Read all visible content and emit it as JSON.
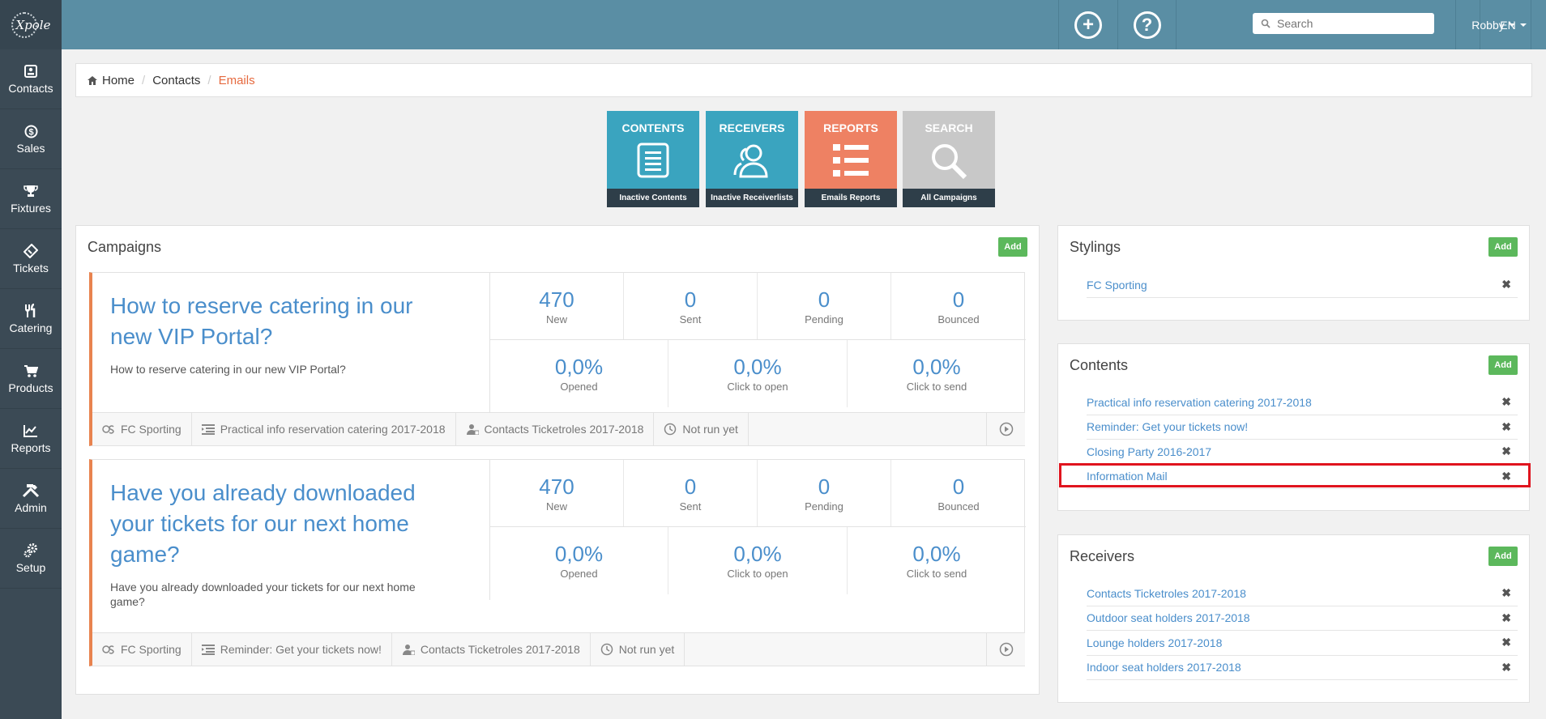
{
  "sidebar": {
    "logo_text": "Xpole",
    "items": [
      {
        "label": "Contacts",
        "icon": "contacts-icon"
      },
      {
        "label": "Sales",
        "icon": "dollar-icon"
      },
      {
        "label": "Fixtures",
        "icon": "trophy-icon"
      },
      {
        "label": "Tickets",
        "icon": "ticket-icon"
      },
      {
        "label": "Catering",
        "icon": "cutlery-icon"
      },
      {
        "label": "Products",
        "icon": "cart-icon"
      },
      {
        "label": "Reports",
        "icon": "line-chart-icon"
      },
      {
        "label": "Admin",
        "icon": "tools-icon"
      },
      {
        "label": "Setup",
        "icon": "gears-icon"
      }
    ]
  },
  "topbar": {
    "search_placeholder": "Search",
    "user": "Robby",
    "language": "EN"
  },
  "breadcrumb": {
    "home": "Home",
    "contacts": "Contacts",
    "current": "Emails"
  },
  "tiles": [
    {
      "title": "CONTENTS",
      "footer": "Inactive Contents",
      "color": "#3aa4bf"
    },
    {
      "title": "RECEIVERS",
      "footer": "Inactive Receiverlists",
      "color": "#3aa4bf"
    },
    {
      "title": "REPORTS",
      "footer": "Emails Reports",
      "color": "#ee8163"
    },
    {
      "title": "SEARCH",
      "footer": "All Campaigns",
      "color": "#c8c8c8"
    }
  ],
  "campaigns": {
    "title": "Campaigns",
    "add_label": "Add",
    "items": [
      {
        "title": "How to reserve catering in our new VIP Portal?",
        "description": "How to reserve catering in our new VIP Portal?",
        "stats_top": [
          {
            "value": "470",
            "label": "New"
          },
          {
            "value": "0",
            "label": "Sent"
          },
          {
            "value": "0",
            "label": "Pending"
          },
          {
            "value": "0",
            "label": "Bounced"
          }
        ],
        "stats_bottom": [
          {
            "value": "0,0%",
            "label": "Opened"
          },
          {
            "value": "0,0%",
            "label": "Click to open"
          },
          {
            "value": "0,0%",
            "label": "Click to send"
          }
        ],
        "styling": "FC Sporting",
        "content": "Practical info reservation catering 2017-2018",
        "receivers": "Contacts Ticketroles 2017-2018",
        "status": "Not run yet"
      },
      {
        "title": "Have you already downloaded your tickets for our next home game?",
        "description": "Have you already downloaded your tickets for our next home game?",
        "stats_top": [
          {
            "value": "470",
            "label": "New"
          },
          {
            "value": "0",
            "label": "Sent"
          },
          {
            "value": "0",
            "label": "Pending"
          },
          {
            "value": "0",
            "label": "Bounced"
          }
        ],
        "stats_bottom": [
          {
            "value": "0,0%",
            "label": "Opened"
          },
          {
            "value": "0,0%",
            "label": "Click to open"
          },
          {
            "value": "0,0%",
            "label": "Click to send"
          }
        ],
        "styling": "FC Sporting",
        "content": "Reminder: Get your tickets now!",
        "receivers": "Contacts Ticketroles 2017-2018",
        "status": "Not run yet"
      }
    ]
  },
  "stylings": {
    "title": "Stylings",
    "add_label": "Add",
    "items": [
      "FC Sporting"
    ]
  },
  "contents": {
    "title": "Contents",
    "add_label": "Add",
    "items": [
      "Practical info reservation catering 2017-2018",
      "Reminder: Get your tickets now!",
      "Closing Party 2016-2017",
      "Information Mail"
    ]
  },
  "receivers": {
    "title": "Receivers",
    "add_label": "Add",
    "items": [
      "Contacts Ticketroles 2017-2018",
      "Outdoor seat holders 2017-2018",
      "Lounge holders 2017-2018",
      "Indoor seat holders 2017-2018"
    ]
  },
  "remove_glyph": "✖"
}
